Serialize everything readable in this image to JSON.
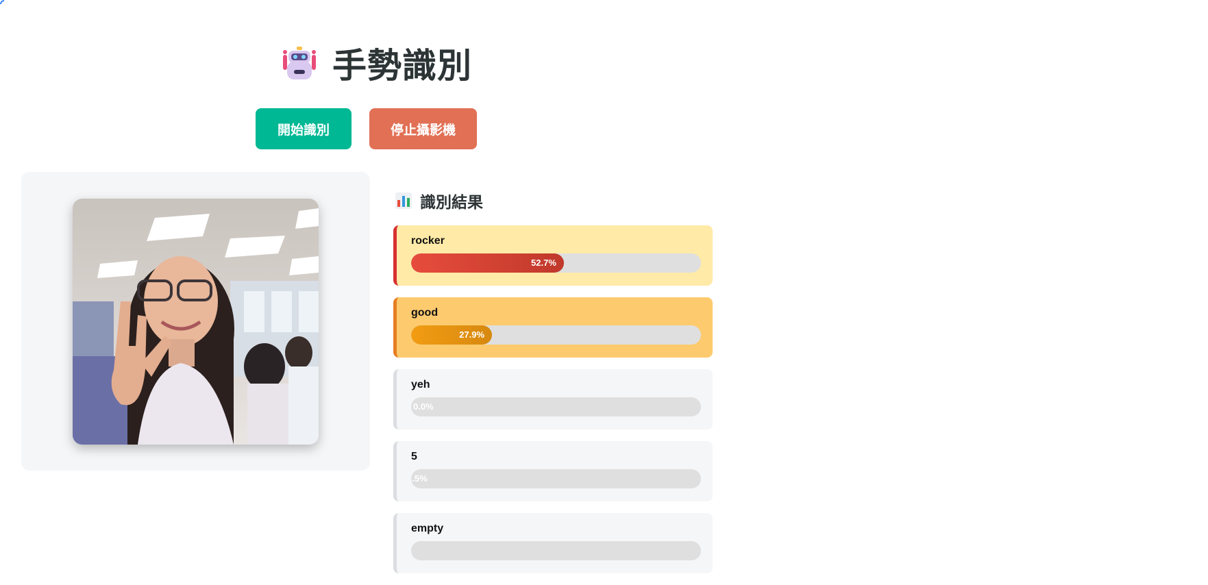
{
  "header": {
    "title": "手勢識別",
    "icon": "robot-icon"
  },
  "controls": {
    "start_label": "開始識別",
    "stop_label": "停止攝影機",
    "start_color": "#00b894",
    "stop_color": "#e17055"
  },
  "camera": {
    "content": "webcam-feed"
  },
  "results": {
    "title": "識別結果",
    "icon": "bar-chart-icon",
    "items": [
      {
        "label": "rocker",
        "percent": 52.7,
        "text": "52.7%",
        "bg": "#ffeaa7",
        "border": "#d63031",
        "bar": [
          "#e74c3c",
          "#c0392b"
        ]
      },
      {
        "label": "good",
        "percent": 27.9,
        "text": "27.9%",
        "bg": "#fdcb6e",
        "border": "#e67e22",
        "bar": [
          "#f39c12",
          "#d68910"
        ]
      },
      {
        "label": "yeh",
        "percent": 0.0,
        "text": "0.0%",
        "bg": "#f5f6f8",
        "border": "#dcdde1",
        "bar": [
          "#dfdfdf",
          "#dfdfdf"
        ]
      },
      {
        "label": "5",
        "percent": 0.0,
        "text": "1.5%",
        "bg": "#f5f6f8",
        "border": "#dcdde1",
        "bar": [
          "#dfdfdf",
          "#dfdfdf"
        ]
      },
      {
        "label": "empty",
        "percent": 0.0,
        "text": "",
        "bg": "#f5f6f8",
        "border": "#dcdde1",
        "bar": [
          "#dfdfdf",
          "#dfdfdf"
        ]
      }
    ]
  }
}
